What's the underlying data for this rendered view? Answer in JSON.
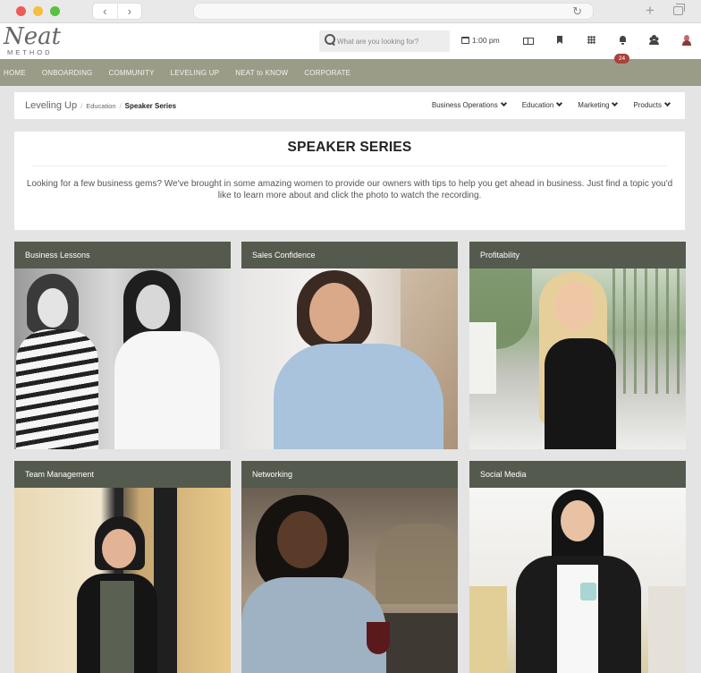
{
  "browser": {
    "back": "‹",
    "forward": "›",
    "reload": "↻",
    "new_tab": "+"
  },
  "logo": {
    "main": "Neat",
    "sub": "METHOD"
  },
  "search": {
    "placeholder": "What are you looking for?"
  },
  "header": {
    "time": "1:00 pm",
    "notification_count": "24"
  },
  "nav": [
    "HOME",
    "ONBOARDING",
    "COMMUNITY",
    "LEVELING UP",
    "NEAT to KNOW",
    "CORPORATE"
  ],
  "breadcrumb": {
    "section": "Leveling Up",
    "parent": "Education",
    "current": "Speaker Series"
  },
  "category_menu": [
    "Business Operations",
    "Education",
    "Marketing",
    "Products"
  ],
  "intro": {
    "title": "SPEAKER SERIES",
    "text": "Looking for a few business gems? We've brought in some amazing women to provide our owners with tips to help you get ahead in business. Just find a topic you'd like to learn more about and click the photo to watch the recording."
  },
  "cards": [
    {
      "title": "Business Lessons"
    },
    {
      "title": "Sales Confidence"
    },
    {
      "title": "Profitability"
    },
    {
      "title": "Team Management"
    },
    {
      "title": "Networking"
    },
    {
      "title": "Social Media"
    }
  ],
  "colors": {
    "nav_bg": "#9b9c88",
    "card_header": "#555a4e",
    "badge": "#a9423a"
  }
}
